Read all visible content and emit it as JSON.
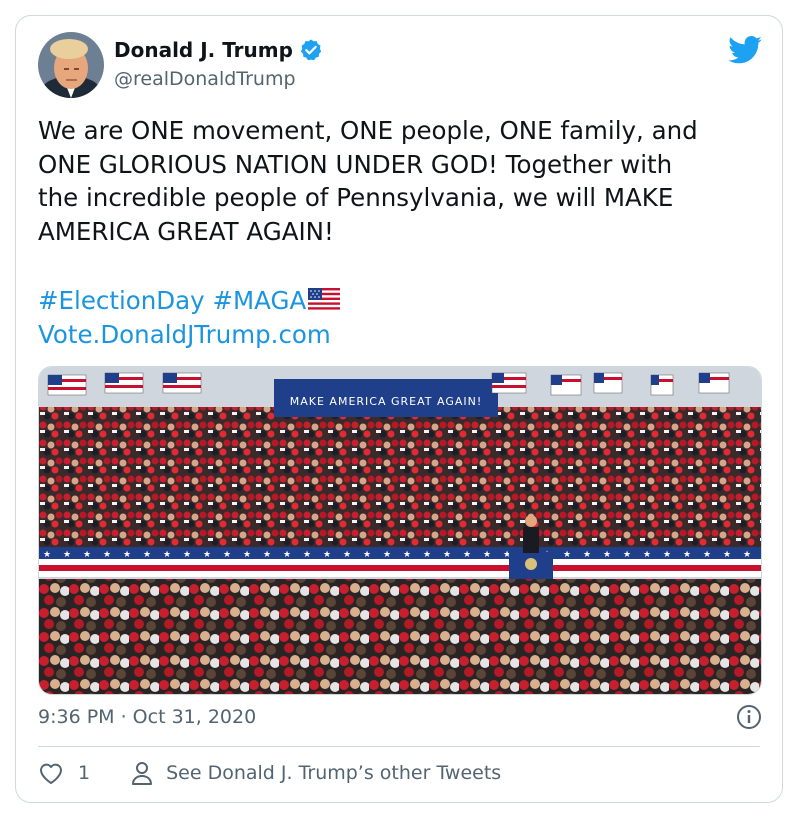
{
  "tweet": {
    "author_name": "Donald J. Trump",
    "handle": "@realDonaldTrump",
    "text": "We are ONE movement, ONE people, ONE family, and\nONE GLORIOUS NATION UNDER GOD! Together with\nthe incredible people of Pennsylvania, we will MAKE\nAMERICA GREAT AGAIN!",
    "hashtags": [
      "#ElectionDay",
      "#MAGA"
    ],
    "link": "Vote.DonaldJTrump.com",
    "timestamp": "9:36 PM · Oct 31, 2020",
    "like_count": "1",
    "other_tweets_label": "See Donald J. Trump’s other Tweets"
  },
  "photo": {
    "banner_text": "MAKE AMERICA GREAT AGAIN!"
  },
  "colors": {
    "link": "#1b95e0",
    "text": "#0f1419",
    "muted": "#536471",
    "border": "#cfd9de",
    "brand": "#1da1f2"
  },
  "icons": {
    "verified": "verified-badge-icon",
    "bird": "twitter-bird-icon",
    "info": "info-icon",
    "heart": "heart-icon",
    "user": "user-icon",
    "flag": "us-flag-icon"
  }
}
